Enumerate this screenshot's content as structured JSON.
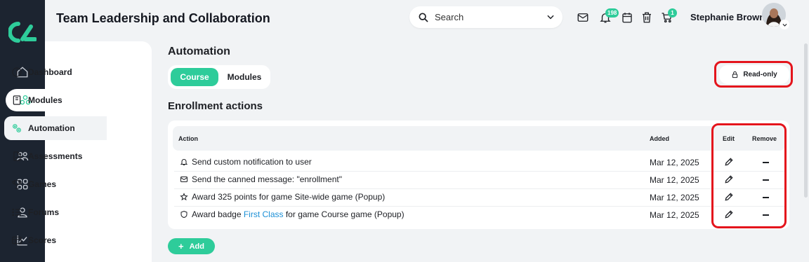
{
  "header": {
    "title": "Team Leadership and Collaboration",
    "search_placeholder": "Search",
    "notifications_count": "198",
    "cart_count": "1",
    "user_name": "Stephanie Brown"
  },
  "rail": {
    "icons": [
      "logo-icon",
      "home-icon",
      "hub-icon",
      "target-icon",
      "users-icon",
      "grid-icon",
      "user-icon",
      "chart-icon"
    ]
  },
  "sidebar": {
    "items": [
      {
        "label": "Dashboard",
        "icon": "dashboard-icon"
      },
      {
        "label": "Modules",
        "icon": "book-icon"
      },
      {
        "label": "Automation",
        "icon": "gears-icon",
        "active": true
      },
      {
        "label": "Assessments",
        "icon": "document-icon"
      },
      {
        "label": "Games",
        "icon": "trophy-icon"
      },
      {
        "label": "Forums",
        "icon": "list-icon"
      },
      {
        "label": "Scores",
        "icon": "table-icon"
      }
    ]
  },
  "main": {
    "heading": "Automation",
    "tabs": [
      {
        "label": "Course",
        "active": true
      },
      {
        "label": "Modules",
        "active": false
      }
    ],
    "readonly_label": "Read-only",
    "section_heading": "Enrollment actions",
    "table": {
      "columns": [
        "Action",
        "Added",
        "Edit",
        "Remove"
      ],
      "rows": [
        {
          "icon": "bell-icon",
          "pre": "Send custom notification to user",
          "link": "",
          "post": "",
          "added": "Mar 12, 2025"
        },
        {
          "icon": "envelope-icon",
          "pre": "Send the canned message: \"enrollment\"",
          "link": "",
          "post": "",
          "added": "Mar 12, 2025"
        },
        {
          "icon": "star-icon",
          "pre": "Award 325 points for game Site-wide game (Popup)",
          "link": "",
          "post": "",
          "added": "Mar 12, 2025"
        },
        {
          "icon": "shield-icon",
          "pre": "Award badge ",
          "link": "First Class",
          "post": " for game Course game (Popup)",
          "added": "Mar 12, 2025"
        }
      ]
    },
    "add_label": "Add"
  },
  "colors": {
    "accent": "#2ecc9a",
    "rail": "#1c2430",
    "highlight": "#e4141c",
    "link": "#1b8fd6"
  }
}
